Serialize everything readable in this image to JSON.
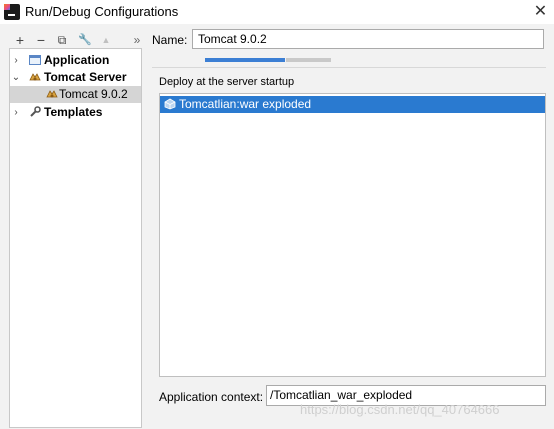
{
  "window": {
    "title": "Run/Debug Configurations",
    "close_glyph": "✕"
  },
  "toolbar": [
    {
      "glyph": "+",
      "name": "add-config-button"
    },
    {
      "glyph": "−",
      "name": "remove-config-button"
    },
    {
      "glyph": "⧉",
      "name": "copy-config-button"
    },
    {
      "glyph": "🔧",
      "name": "edit-defaults-button"
    },
    {
      "glyph": "▲",
      "name": "move-up-button"
    },
    {
      "glyph": "»",
      "name": "more-actions-button"
    }
  ],
  "tree": [
    {
      "label": "Application",
      "arrow": "›",
      "level": 0,
      "bold": true,
      "icon": "application-icon"
    },
    {
      "label": "Tomcat Server",
      "arrow": "⌄",
      "level": 0,
      "bold": true,
      "icon": "tomcat-icon"
    },
    {
      "label": "Tomcat 9.0.2",
      "arrow": "",
      "level": 1,
      "bold": false,
      "icon": "tomcat-icon",
      "selected": true
    },
    {
      "label": "Templates",
      "arrow": "›",
      "level": 0,
      "bold": true,
      "icon": "wrench-icon"
    }
  ],
  "name_field": {
    "label": "Name:",
    "value": "Tomcat 9.0.2"
  },
  "deploy": {
    "title": "Deploy at the server startup",
    "items": [
      "Tomcatlian:war exploded"
    ]
  },
  "context": {
    "label": "Application context:",
    "value": "/Tomcatlian_war_exploded"
  },
  "watermark": "https://blog.csdn.net/qq_40764666",
  "colors": {
    "selection": "#2a7ad0",
    "tab_active": "#3c7fd4"
  }
}
